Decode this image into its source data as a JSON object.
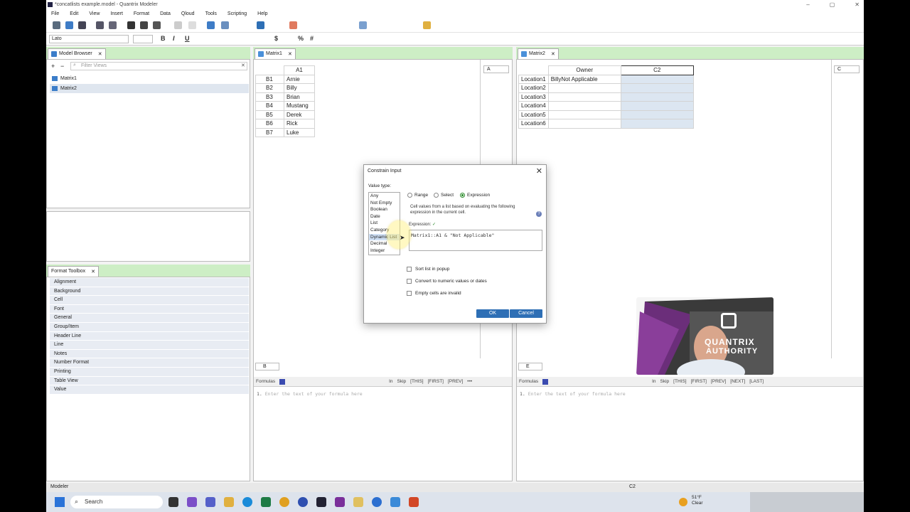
{
  "window": {
    "title": "*concatlists example.model - Quantrix Modeler",
    "controls": [
      "–",
      "▢",
      "✕"
    ]
  },
  "menu": [
    "File",
    "Edit",
    "View",
    "Insert",
    "Format",
    "Data",
    "Qloud",
    "Tools",
    "Scripting",
    "Help"
  ],
  "format_bar": {
    "font": "Lato",
    "size": "",
    "bold": "B",
    "italic": "I",
    "underline": "U",
    "currency": "$",
    "percent": "%",
    "hash": "#"
  },
  "model_browser": {
    "tab": "Model Browser",
    "filter_placeholder": "Filter Views",
    "items": [
      "Matrix1",
      "Matrix2"
    ],
    "add": "+",
    "remove": "−"
  },
  "format_toolbox": {
    "tab": "Format Toolbox",
    "items": [
      "Alignment",
      "Background",
      "Cell",
      "Font",
      "General",
      "Group/Item",
      "Header Line",
      "Line",
      "Notes",
      "Number Format",
      "Printing",
      "Table View",
      "Value"
    ]
  },
  "matrix1": {
    "tab": "Matrix1",
    "col_header": "A1",
    "rows": [
      [
        "B1",
        "Arnie"
      ],
      [
        "B2",
        "Billy"
      ],
      [
        "B3",
        "Brian"
      ],
      [
        "B4",
        "Mustang"
      ],
      [
        "B5",
        "Derek"
      ],
      [
        "B6",
        "Rick"
      ],
      [
        "B7",
        "Luke"
      ]
    ],
    "tray_col": "A",
    "tray_row": "B"
  },
  "matrix2": {
    "tab": "Matrix2",
    "col_headers": [
      "Owner",
      "C2"
    ],
    "rows": [
      [
        "Location1",
        "BillyNot Applicable",
        ""
      ],
      [
        "Location2",
        "",
        ""
      ],
      [
        "Location3",
        "",
        ""
      ],
      [
        "Location4",
        "",
        ""
      ],
      [
        "Location5",
        "",
        ""
      ],
      [
        "Location6",
        "",
        ""
      ]
    ],
    "tray_col": "C",
    "tray_row": "E"
  },
  "formula_bar": {
    "label": "Formulas",
    "tokens_left": [
      "In",
      "Skip",
      "[THIS]",
      "[FIRST]",
      "[PREV]",
      "•••"
    ],
    "tokens_right": [
      "In",
      "Skip",
      "[THIS]",
      "[FIRST]",
      "[PREV]",
      "[NEXT]",
      "[LAST]"
    ],
    "line_number": "1.",
    "placeholder": "Enter the text of your formula here"
  },
  "dialog": {
    "title": "Constrain Input",
    "value_type_label": "Value type:",
    "value_types": [
      "Any",
      "Not Empty",
      "Boolean",
      "Date",
      "List",
      "Category",
      "Dynamic List",
      "Decimal",
      "Integer"
    ],
    "selected_type": "Dynamic List",
    "radios": [
      "Range",
      "Select",
      "Expression"
    ],
    "selected_radio": "Expression",
    "description": "Cell values from a list based on evaluating the following expression in the current cell.",
    "expression_label": "Expression:",
    "expression_check": "✓",
    "expression": "Matrix1::A1 & \"Not Applicable\"",
    "checkboxes": [
      "Sort list in popup",
      "Convert to numeric values or dates",
      "Empty cells are invalid"
    ],
    "ok": "OK",
    "cancel": "Cancel",
    "help": "?"
  },
  "status": {
    "left": "Modeler",
    "center": "C2"
  },
  "taskbar": {
    "search": "Search",
    "weather_temp": "51°F",
    "weather_cond": "Clear"
  },
  "video_overlay": {
    "logo_line1": "QUANTRIX",
    "logo_line2": "AUTHORITY"
  },
  "colors": {
    "tab_green": "#cdeec5",
    "accent_blue": "#2e6fb5",
    "selection": "#dce6f1"
  }
}
